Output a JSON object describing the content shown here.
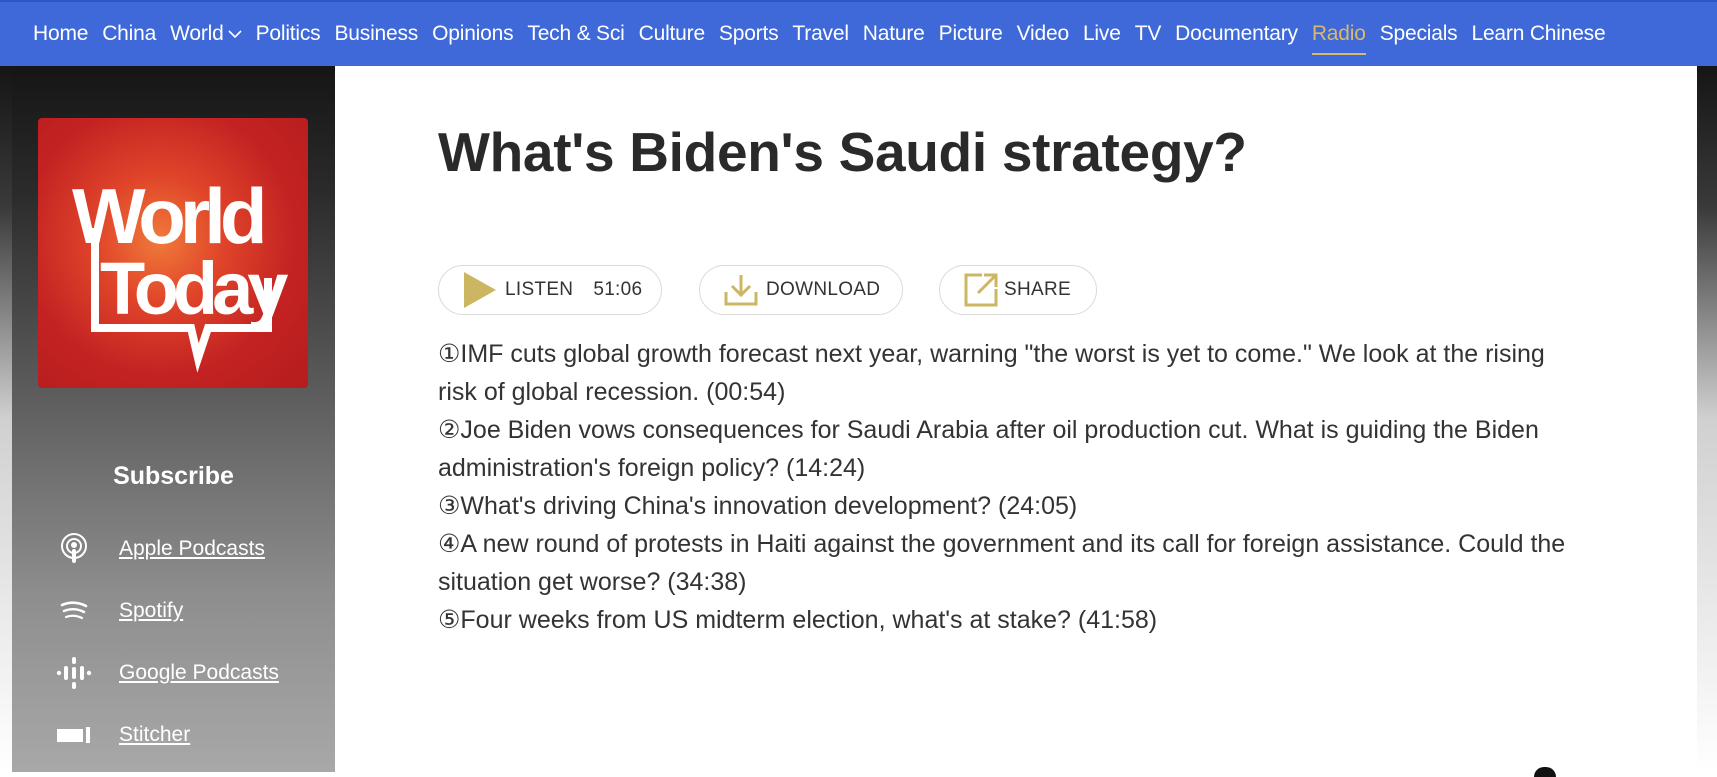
{
  "nav": {
    "items": [
      {
        "label": "Home"
      },
      {
        "label": "China"
      },
      {
        "label": "World",
        "dropdown": true
      },
      {
        "label": "Politics"
      },
      {
        "label": "Business"
      },
      {
        "label": "Opinions"
      },
      {
        "label": "Tech & Sci"
      },
      {
        "label": "Culture"
      },
      {
        "label": "Sports"
      },
      {
        "label": "Travel"
      },
      {
        "label": "Nature"
      },
      {
        "label": "Picture"
      },
      {
        "label": "Video"
      },
      {
        "label": "Live"
      },
      {
        "label": "TV"
      },
      {
        "label": "Documentary"
      },
      {
        "label": "Radio",
        "active": true
      },
      {
        "label": "Specials"
      },
      {
        "label": "Learn Chinese"
      }
    ],
    "colors": {
      "background": "#3f69d8",
      "active": "#d9b96a",
      "text": "#ffffff"
    }
  },
  "sidebar": {
    "logo": {
      "line1": "World",
      "line2": "Today"
    },
    "subscribe_heading": "Subscribe",
    "links": [
      {
        "label": "Apple Podcasts",
        "icon": "podcast-icon"
      },
      {
        "label": "Spotify",
        "icon": "spotify-icon"
      },
      {
        "label": "Google Podcasts",
        "icon": "google-podcasts-icon"
      },
      {
        "label": "Stitcher",
        "icon": "stitcher-icon"
      }
    ]
  },
  "episode": {
    "title": "What's Biden's Saudi strategy?",
    "listen_label": "LISTEN",
    "duration": "51:06",
    "download_label": "DOWNLOAD",
    "share_label": "SHARE",
    "accent_color": "#cdb661",
    "description": [
      "①IMF cuts global growth forecast next year, warning \"the worst is yet to come.\" We look at the rising risk of global recession. (00:54)",
      "②Joe Biden vows consequences for Saudi Arabia after oil production cut. What is guiding the Biden administration's foreign policy? (14:24)",
      "③What's driving China's innovation development? (24:05)",
      "④A new round of protests in Haiti against the government and its call for foreign assistance. Could the situation get worse? (34:38)",
      "⑤Four weeks from US midterm election, what's at stake? (41:58)"
    ]
  }
}
